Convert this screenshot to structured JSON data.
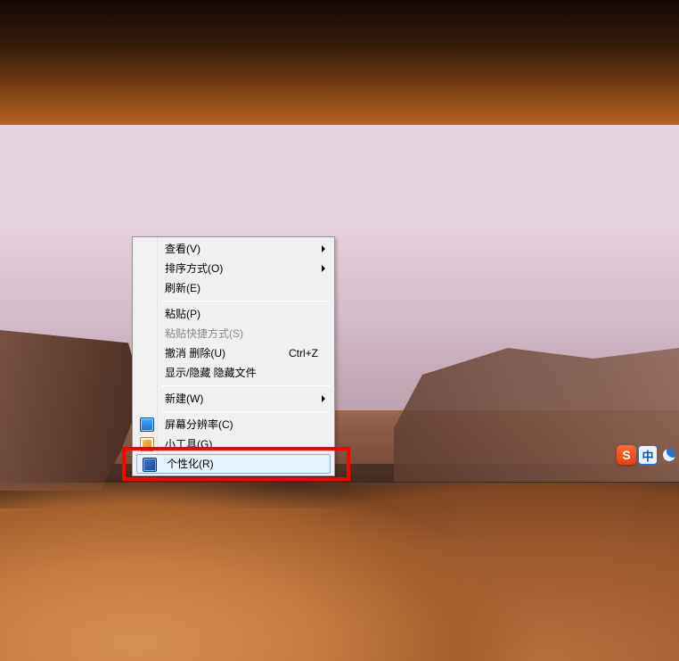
{
  "context_menu": {
    "items": [
      {
        "id": "view",
        "label": "查看(V)",
        "submenu": true,
        "enabled": true,
        "icon": null
      },
      {
        "id": "sort",
        "label": "排序方式(O)",
        "submenu": true,
        "enabled": true,
        "icon": null
      },
      {
        "id": "refresh",
        "label": "刷新(E)",
        "enabled": true,
        "icon": null
      },
      {
        "sep": true
      },
      {
        "id": "paste",
        "label": "粘贴(P)",
        "enabled": true,
        "icon": null
      },
      {
        "id": "paste-shortcut",
        "label": "粘贴快捷方式(S)",
        "enabled": false,
        "icon": null
      },
      {
        "id": "undo-delete",
        "label": "撤消 删除(U)",
        "shortcut": "Ctrl+Z",
        "enabled": true,
        "icon": null
      },
      {
        "id": "show-hide-hidden",
        "label": "显示/隐藏 隐藏文件",
        "enabled": true,
        "icon": null
      },
      {
        "sep": true
      },
      {
        "id": "new",
        "label": "新建(W)",
        "submenu": true,
        "enabled": true,
        "icon": null
      },
      {
        "sep": true
      },
      {
        "id": "screen-resolution",
        "label": "屏幕分辨率(C)",
        "enabled": true,
        "icon": "screenres"
      },
      {
        "id": "gadgets",
        "label": "小工具(G)",
        "enabled": true,
        "icon": "gadget"
      },
      {
        "id": "personalize",
        "label": "个性化(R)",
        "enabled": true,
        "icon": "personalize",
        "hover": true
      }
    ]
  },
  "ime": {
    "sogou_logo_letter": "S",
    "lang_label": "中",
    "mode_icon": "moon"
  },
  "annotation": {
    "highlighted_item_id": "personalize"
  }
}
